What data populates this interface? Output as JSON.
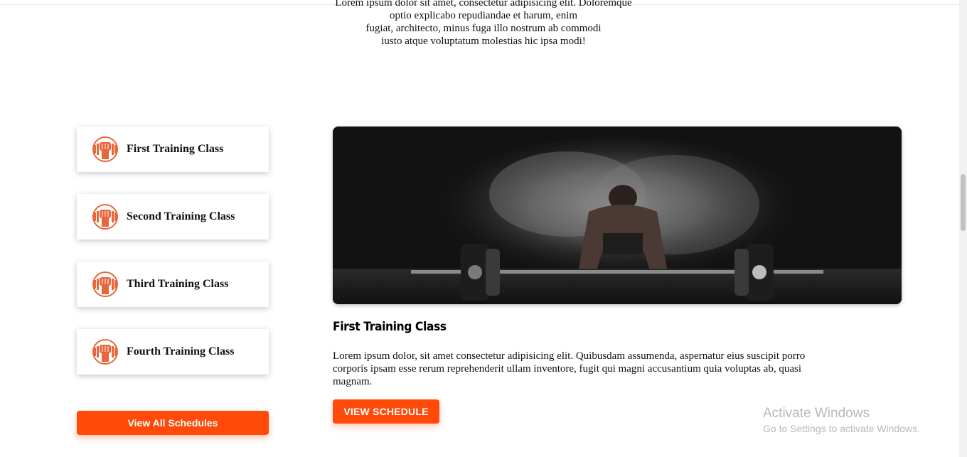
{
  "intro": {
    "lines": [
      "Lorem ipsum dolor sit amet, consectetur adipisicing elit. Doloremque",
      "optio explicabo repudiandae et harum, enim",
      "fugiat, architecto, minus fuga illo nostrum ab commodi",
      "iusto atque voluptatum molestias hic ipsa modi!"
    ]
  },
  "classes": [
    {
      "label": "First Training Class",
      "icon": "dumbbell-fist-icon"
    },
    {
      "label": "Second Training Class",
      "icon": "dumbbell-fist-icon"
    },
    {
      "label": "Third Training Class",
      "icon": "dumbbell-fist-icon"
    },
    {
      "label": "Fourth Training Class",
      "icon": "dumbbell-fist-icon"
    }
  ],
  "view_all_label": "View All Schedules",
  "detail": {
    "title": "First Training Class",
    "text": "Lorem ipsum dolor, sit amet consectetur adipisicing elit. Quibusdam assumenda, aspernatur eius suscipit porro corporis ipsam esse rerum reprehenderit ullam inventore, fugit qui magni accusantium quia voluptas ab, quasi magnam.",
    "button_label": "VIEW SCHEDULE",
    "image": "athlete-deadlift-chalk-photo"
  },
  "watermark": {
    "line1": "Activate Windows",
    "line2": "Go to Settings to activate Windows."
  },
  "colors": {
    "accent": "#ff4a0a",
    "icon": "#e8663a"
  }
}
